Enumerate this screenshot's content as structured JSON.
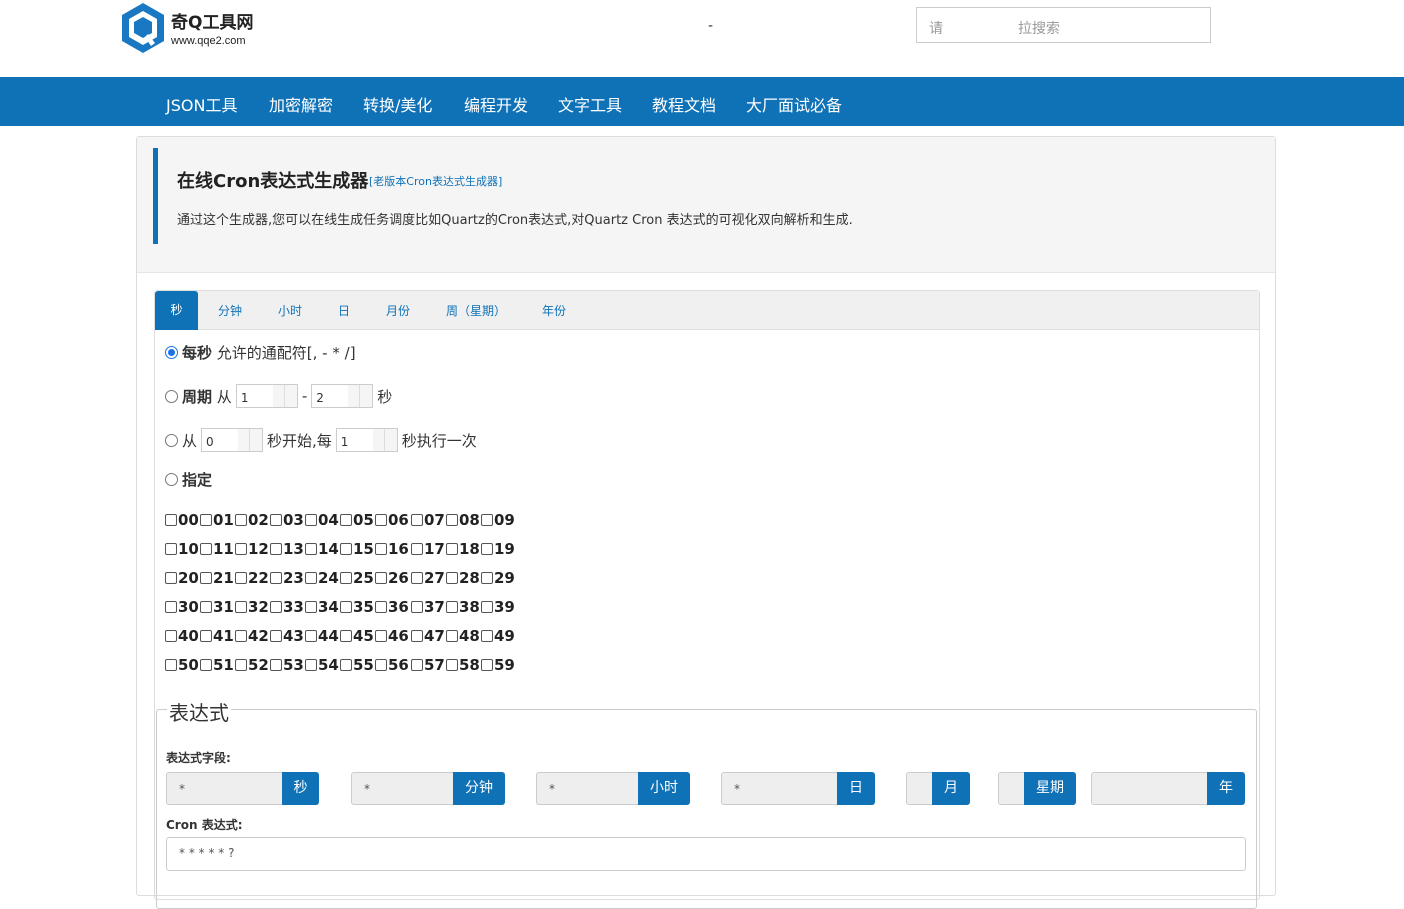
{
  "header": {
    "brand_name": "奇Q工具网",
    "brand_url": "www.qqe2.com",
    "center_text": "-",
    "search_placeholder_a": "请",
    "search_placeholder_b": "拉搜索"
  },
  "nav": {
    "items": [
      "JSON工具",
      "加密解密",
      "转换/美化",
      "编程开发",
      "文字工具",
      "教程文档",
      "大厂面试必备"
    ]
  },
  "intro": {
    "title": "在线Cron表达式生成器",
    "old_version_link": "[老版本Cron表达式生成器]",
    "description": "通过这个生成器,您可以在线生成任务调度比如Quartz的Cron表达式,对Quartz Cron 表达式的可视化双向解析和生成."
  },
  "tabs": [
    "秒",
    "分钟",
    "小时",
    "日",
    "月份",
    "周（星期）",
    "年份"
  ],
  "second_tab": {
    "every": {
      "label": "每秒",
      "hint": "允许的通配符[, - * /]"
    },
    "cycle": {
      "label": "周期",
      "from": "从",
      "from_value": "1",
      "sep": "-",
      "to_value": "2",
      "unit": "秒"
    },
    "step": {
      "from": "从",
      "start_value": "0",
      "start_suffix": "秒开始,每",
      "every_value": "1",
      "every_suffix": "秒执行一次"
    },
    "specify": {
      "label": "指定"
    },
    "values": [
      "00",
      "01",
      "02",
      "03",
      "04",
      "05",
      "06",
      "07",
      "08",
      "09",
      "10",
      "11",
      "12",
      "13",
      "14",
      "15",
      "16",
      "17",
      "18",
      "19",
      "20",
      "21",
      "22",
      "23",
      "24",
      "25",
      "26",
      "27",
      "28",
      "29",
      "30",
      "31",
      "32",
      "33",
      "34",
      "35",
      "36",
      "37",
      "38",
      "39",
      "40",
      "41",
      "42",
      "43",
      "44",
      "45",
      "46",
      "47",
      "48",
      "49",
      "50",
      "51",
      "52",
      "53",
      "54",
      "55",
      "56",
      "57",
      "58",
      "59"
    ]
  },
  "expression": {
    "legend": "表达式",
    "fields_label": "表达式字段:",
    "fields": [
      {
        "value": "*",
        "label": "秒"
      },
      {
        "value": "*",
        "label": "分钟"
      },
      {
        "value": "*",
        "label": "小时"
      },
      {
        "value": "*",
        "label": "日"
      },
      {
        "value": "",
        "label": "月"
      },
      {
        "value": "",
        "label": "星期"
      },
      {
        "value": "",
        "label": "年"
      }
    ],
    "cron_label": "Cron 表达式:",
    "cron_value": "* * * * * ?"
  },
  "colors": {
    "primary": "#0f72b7",
    "radio_checked": "#1a73e8"
  }
}
